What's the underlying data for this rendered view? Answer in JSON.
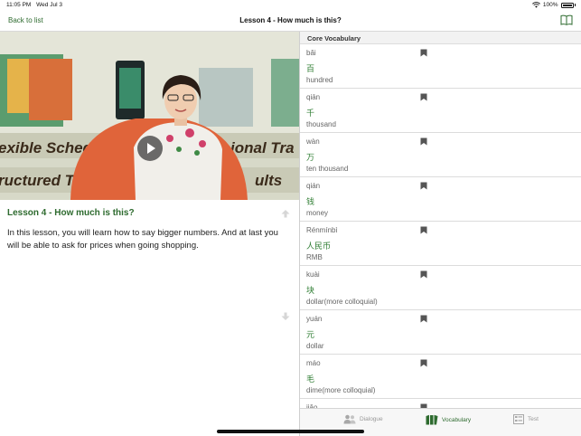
{
  "status_bar": {
    "time": "11:05 PM",
    "date": "Wed Jul 3",
    "battery": "100%"
  },
  "nav": {
    "back_label": "Back to list",
    "title": "Lesson 4 - How much is this?"
  },
  "lesson": {
    "title": "Lesson 4 - How much is this?",
    "description": "In this lesson, you will learn how to say bigger numbers. And at last you will be able to ask for prices when going shopping."
  },
  "video": {
    "banner_line1": "exible Scheduling",
    "banner_line1b": "ional Tra",
    "banner_line2": "ructured Tr",
    "banner_line2b": "ults"
  },
  "vocab": {
    "header": "Core Vocabulary",
    "items": [
      {
        "pinyin": "bǎi",
        "hanzi": "百",
        "meaning": "hundred"
      },
      {
        "pinyin": "qiān",
        "hanzi": "千",
        "meaning": "thousand"
      },
      {
        "pinyin": "wàn",
        "hanzi": "万",
        "meaning": "ten thousand"
      },
      {
        "pinyin": "qián",
        "hanzi": "钱",
        "meaning": "money"
      },
      {
        "pinyin": "Rénmínbì",
        "hanzi": "人民币",
        "meaning": "RMB"
      },
      {
        "pinyin": "kuài",
        "hanzi": "块",
        "meaning": "dollar(more colloquial)"
      },
      {
        "pinyin": "yuán",
        "hanzi": "元",
        "meaning": "dollar"
      },
      {
        "pinyin": "máo",
        "hanzi": "毛",
        "meaning": "dime(more colloquial)"
      },
      {
        "pinyin": "jiǎo",
        "hanzi": "",
        "meaning": ""
      }
    ]
  },
  "tabs": [
    {
      "label": "Dialogue",
      "icon": "people-icon",
      "active": false
    },
    {
      "label": "Vocabulary",
      "icon": "vocabulary-icon",
      "active": true
    },
    {
      "label": "Test",
      "icon": "test-icon",
      "active": false
    }
  ],
  "colors": {
    "accent": "#2e6b2f",
    "hanzi": "#2e7d32",
    "video_chair": "#e0643a"
  }
}
